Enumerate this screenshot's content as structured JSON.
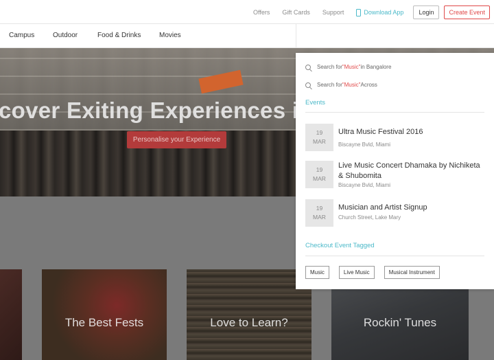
{
  "topnav": {
    "offers": "Offers",
    "gift_cards": "Gift Cards",
    "support": "Support",
    "download_app": "Download App",
    "login": "Login",
    "create_event": "Create Event"
  },
  "categories": [
    "Campus",
    "Outdoor",
    "Food & Drinks",
    "Movies"
  ],
  "hero": {
    "title": "cover Exiting Experiences in",
    "cta": "Personalise your Experience"
  },
  "cards": [
    "",
    "The Best Fests",
    "Love to Learn?",
    "Rockin' Tunes"
  ],
  "search": {
    "suggestions": [
      {
        "prefix": "Search for ",
        "term": "\"Music\"",
        "suffix": " in Bangalore"
      },
      {
        "prefix": "Search for ",
        "term": "\"Music\"",
        "suffix": " Across"
      }
    ],
    "events_heading": "Events",
    "events": [
      {
        "day": "19",
        "month": "MAR",
        "name": "Ultra Music Festival 2016",
        "location": "Biscayne Bvld, Miami"
      },
      {
        "day": "19",
        "month": "MAR",
        "name": "Live Music Concert Dhamaka by Nichiketa & Shubomita",
        "location": "Biscayne Bvld, Miami"
      },
      {
        "day": "19",
        "month": "MAR",
        "name": "Musician and Artist Signup",
        "location": "Church Street, Lake Mary"
      }
    ],
    "tagged_heading": "Checkout Event Tagged",
    "tags": [
      "Music",
      "Live Music",
      "Musical Instrument"
    ]
  },
  "colors": {
    "accent": "#4bb9c9",
    "brand_red": "#e04848",
    "overlay_gray": "#7a7a7a"
  }
}
